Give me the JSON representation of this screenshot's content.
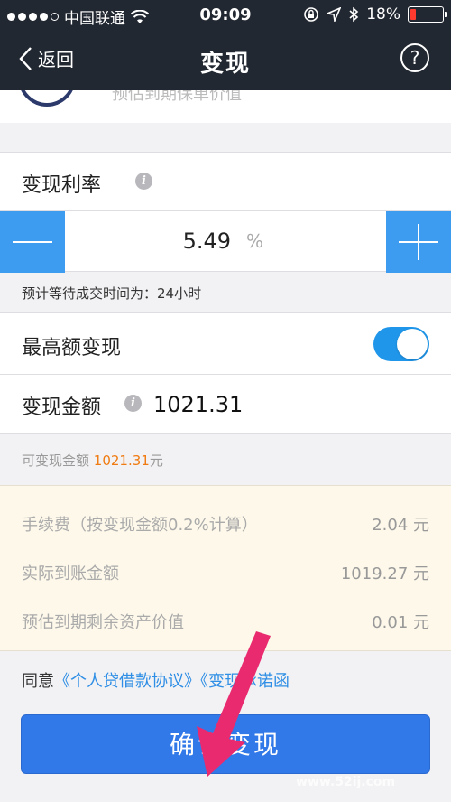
{
  "status": {
    "carrier": "中国联通",
    "time": "09:09",
    "battery": "18%",
    "battery_level": 0.18
  },
  "nav": {
    "back": "返回",
    "title": "变现",
    "help": "?"
  },
  "top_card": {
    "cut_text": "预估到期保单价值"
  },
  "rate": {
    "label": "变现利率",
    "value": "5.49",
    "unit": "%"
  },
  "hint": "预计等待成交时间为：24小时",
  "max_cash": {
    "label": "最高额变现",
    "enabled": true
  },
  "amount": {
    "label": "变现金额",
    "value": "1021.31"
  },
  "available": {
    "prefix": "可变现金额",
    "value": "1021.31",
    "suffix": "元"
  },
  "fees": [
    {
      "label": "手续费（按变现金额0.2%计算）",
      "value": "2.04 元"
    },
    {
      "label": "实际到账金额",
      "value": "1019.27 元"
    },
    {
      "label": "预估到期剩余资产价值",
      "value": "0.01 元"
    }
  ],
  "agree": {
    "prefix": "同意",
    "link1": "《个人贷借款协议》",
    "link2": "《变现承诺函"
  },
  "confirm": "确认变现",
  "watermark": "www.52ij.com",
  "colors": {
    "primary": "#3178e8",
    "stepper": "#3d9cf0",
    "accent_orange": "#f07b12",
    "navbar": "#222831",
    "arrow": "#ea2a6f"
  }
}
